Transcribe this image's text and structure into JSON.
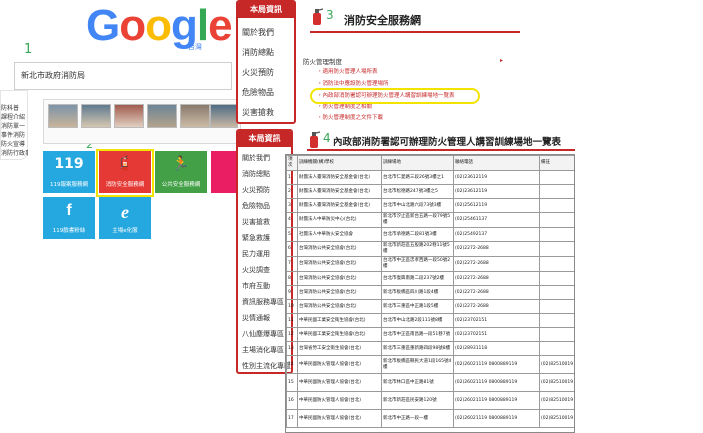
{
  "google_logo": {
    "letters": [
      {
        "ch": "G",
        "color": "#4285f4"
      },
      {
        "ch": "o",
        "color": "#ea4335"
      },
      {
        "ch": "o",
        "color": "#fbbc05"
      },
      {
        "ch": "g",
        "color": "#4285f4"
      },
      {
        "ch": "l",
        "color": "#34a853"
      },
      {
        "ch": "e",
        "color": "#ea4335"
      }
    ],
    "sub": "台灣"
  },
  "step_labels": {
    "one": "1",
    "two": "2"
  },
  "site": {
    "title": "新北市政府消防局"
  },
  "left_nav": {
    "items": [
      "",
      "防科普",
      "課程介紹",
      "消防單一",
      "事件消防",
      "防火宣導",
      "消防行政事項"
    ]
  },
  "photo_captions": [
    "",
    "",
    "",
    "",
    "",
    ""
  ],
  "tiles": [
    {
      "label": "119報案服務網",
      "icon": "119",
      "color": "#25a7df"
    },
    {
      "label": "消防安全服務網",
      "icon": "🧯",
      "color": "#e53935"
    },
    {
      "label": "公共安全服務網",
      "icon": "🏃",
      "color": "#43a047"
    },
    {
      "label": "",
      "icon": "",
      "color": "#e91e63"
    },
    {
      "label": "119臉書粉絲",
      "icon": "f",
      "color": "#25a7df"
    },
    {
      "label": "主場e化服",
      "icon": "e",
      "color": "#25a7df"
    }
  ],
  "panel1": {
    "title": "本局資訊",
    "items": [
      "關於我們",
      "消防總點",
      "火災預防",
      "危險物品",
      "災害搶救"
    ]
  },
  "panel2": {
    "title": "本局資訊",
    "items": [
      "關於我們",
      "消防總點",
      "火災預防",
      "危險物品",
      "災害搶救",
      "緊急救護",
      "民力運用",
      "火災調查",
      "市府互動",
      "資訊服務專區",
      "災情通報",
      "八仙塵爆專區",
      "主場消化專區",
      "性別主流化專區"
    ]
  },
  "heading3": {
    "num": "3",
    "text": "消防安全服務網"
  },
  "links": {
    "head": "防火管理制度",
    "items": [
      "・適用防火管理人場所表",
      "・消防法中應設防火管理場所",
      "・內政部消防署認可辦理防火管理人講習訓練場地一覽表",
      "・防火管理制度之相關",
      "・防火管理制度之文件下載"
    ]
  },
  "heading4": {
    "num": "4",
    "text": "內政部消防署認可辦理防火管理人講習訓練場地一覽表"
  },
  "table": {
    "headers": [
      "項次",
      "訓練機關(構)學校",
      "訓練場地",
      "聯絡電話",
      "備註"
    ],
    "rows": [
      [
        "1",
        "財團法人臺灣消防安全基金會(台北)",
        "台北市仁愛路三段26號3樓之1",
        "(02)23612119",
        ""
      ],
      [
        "2",
        "財團法人臺灣消防安全基金會(台北)",
        "台北市松德路247號3樓之5",
        "(02)23612119",
        ""
      ],
      [
        "3",
        "財團法人臺灣消防安全基金會(台北)",
        "台北市中山北路六段73號3樓",
        "(02)25612119",
        ""
      ],
      [
        "4",
        "財團法人中華防災中心(台北)",
        "新北市汐止區新台五路一段79號5樓",
        "(02)25461137",
        ""
      ],
      [
        "5",
        "社團法人中華防火安全協會",
        "台北市承德路二段81號3樓",
        "(02)25492137",
        ""
      ],
      [
        "6",
        "台灣消防公共安全協會(台北)",
        "新北市新莊區五股路202巷11號5樓",
        "(02)2272-2688",
        ""
      ],
      [
        "7",
        "台灣消防公共安全協會(台北)",
        "台北市中正區忠孝西路一段50號2樓",
        "(02)2272-2688",
        ""
      ],
      [
        "8",
        "台灣消防公共安全協會(台北)",
        "台北市復興南路二段237號2樓",
        "(02)2272-2688",
        ""
      ],
      [
        "9",
        "台灣消防公共安全協會(台北)",
        "新北市板橋區四川路1段4樓",
        "(02)2272-2688",
        ""
      ],
      [
        "10",
        "台灣消防公共安全協會(台北)",
        "新北市三重區中正路1段5樓",
        "(02)2272-2688",
        ""
      ],
      [
        "11",
        "中華民國工業安全衛生協會(台北)",
        "台北市中山北路2段111號8樓",
        "(02)23702151",
        ""
      ],
      [
        "12",
        "中華民國工業安全衛生協會(台北)",
        "台北市中正區南昌路一段51巷7號",
        "(02)23702151",
        ""
      ],
      [
        "13",
        "台灣省勞工安全衛生協會(台北)",
        "新北市三重區重新路四段98號8樓",
        "(02)28931118",
        ""
      ],
      [
        "14",
        "中華民國防火管理人協會(台北)",
        "新北市板橋區縣民大道1段165號4樓",
        "(02)26021119 0800889119",
        "(02)82510019"
      ],
      [
        "15",
        "中華民國防火管理人協會(台北)",
        "新北市林口區中正路81號",
        "(02)26021119 0800889119",
        "(02)82510019"
      ],
      [
        "16",
        "中華民國防火管理人協會(台北)",
        "新北市新莊區民安路120號",
        "(02)26021119 0800889119",
        "(02)82510019"
      ],
      [
        "17",
        "中華民國防火管理人協會(台北)",
        "新北市中正路一段一樓",
        "(02)26021119 0800889119",
        "(02)82510019"
      ]
    ]
  }
}
